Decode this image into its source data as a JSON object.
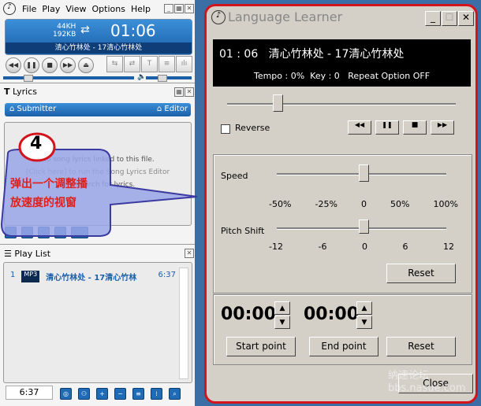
{
  "player": {
    "menu": [
      "File",
      "Play",
      "View",
      "Options",
      "Help"
    ],
    "bitrate_khz": "44KH",
    "bitrate_kb": "192KB",
    "time": "01:06",
    "track": "清心竹林处 - 17清心竹林处"
  },
  "lyrics": {
    "title": "Lyrics",
    "submitter": "Submitter",
    "editor": "Editor",
    "line1": "No song lyrics linked to this file.",
    "line2": "[Click here] to run the Song Lyrics Editor",
    "line3": "and search for lyrics."
  },
  "callout": {
    "number": "4",
    "line1": "弹出一个调整播",
    "line2": "放速度的视窗"
  },
  "playlist": {
    "title": "Play List",
    "items": [
      {
        "index": "1",
        "format": "MP3",
        "title": "清心竹林处 - 17清心竹林",
        "duration": "6:37"
      }
    ],
    "total": "6:37"
  },
  "dialog": {
    "title": "Language Learner",
    "display_line1": "01 : 06   清心竹林处 - 17清心竹林处",
    "display_line2": "Tempo : 0%  Key : 0   Repeat Option OFF",
    "reverse_label": "Reverse",
    "reverse_checked": false,
    "position_fraction": 0.22,
    "speed_label": "Speed",
    "speed_ticks": [
      "-50%",
      "-25%",
      "0",
      "50%",
      "100%"
    ],
    "speed_value": "0",
    "pitch_label": "Pitch Shift",
    "pitch_ticks": [
      "-12",
      "-6",
      "0",
      "6",
      "12"
    ],
    "pitch_value": "0",
    "reset": "Reset",
    "start_time": "00:00",
    "end_time": "00:00",
    "start_point": "Start point",
    "end_point": "End point",
    "reset2": "Reset",
    "close": "Close"
  },
  "watermark": "纳速论坛 bbs.nasue.com",
  "colors": {
    "accent": "#1a5fa8",
    "highlight": "#d4141c"
  }
}
